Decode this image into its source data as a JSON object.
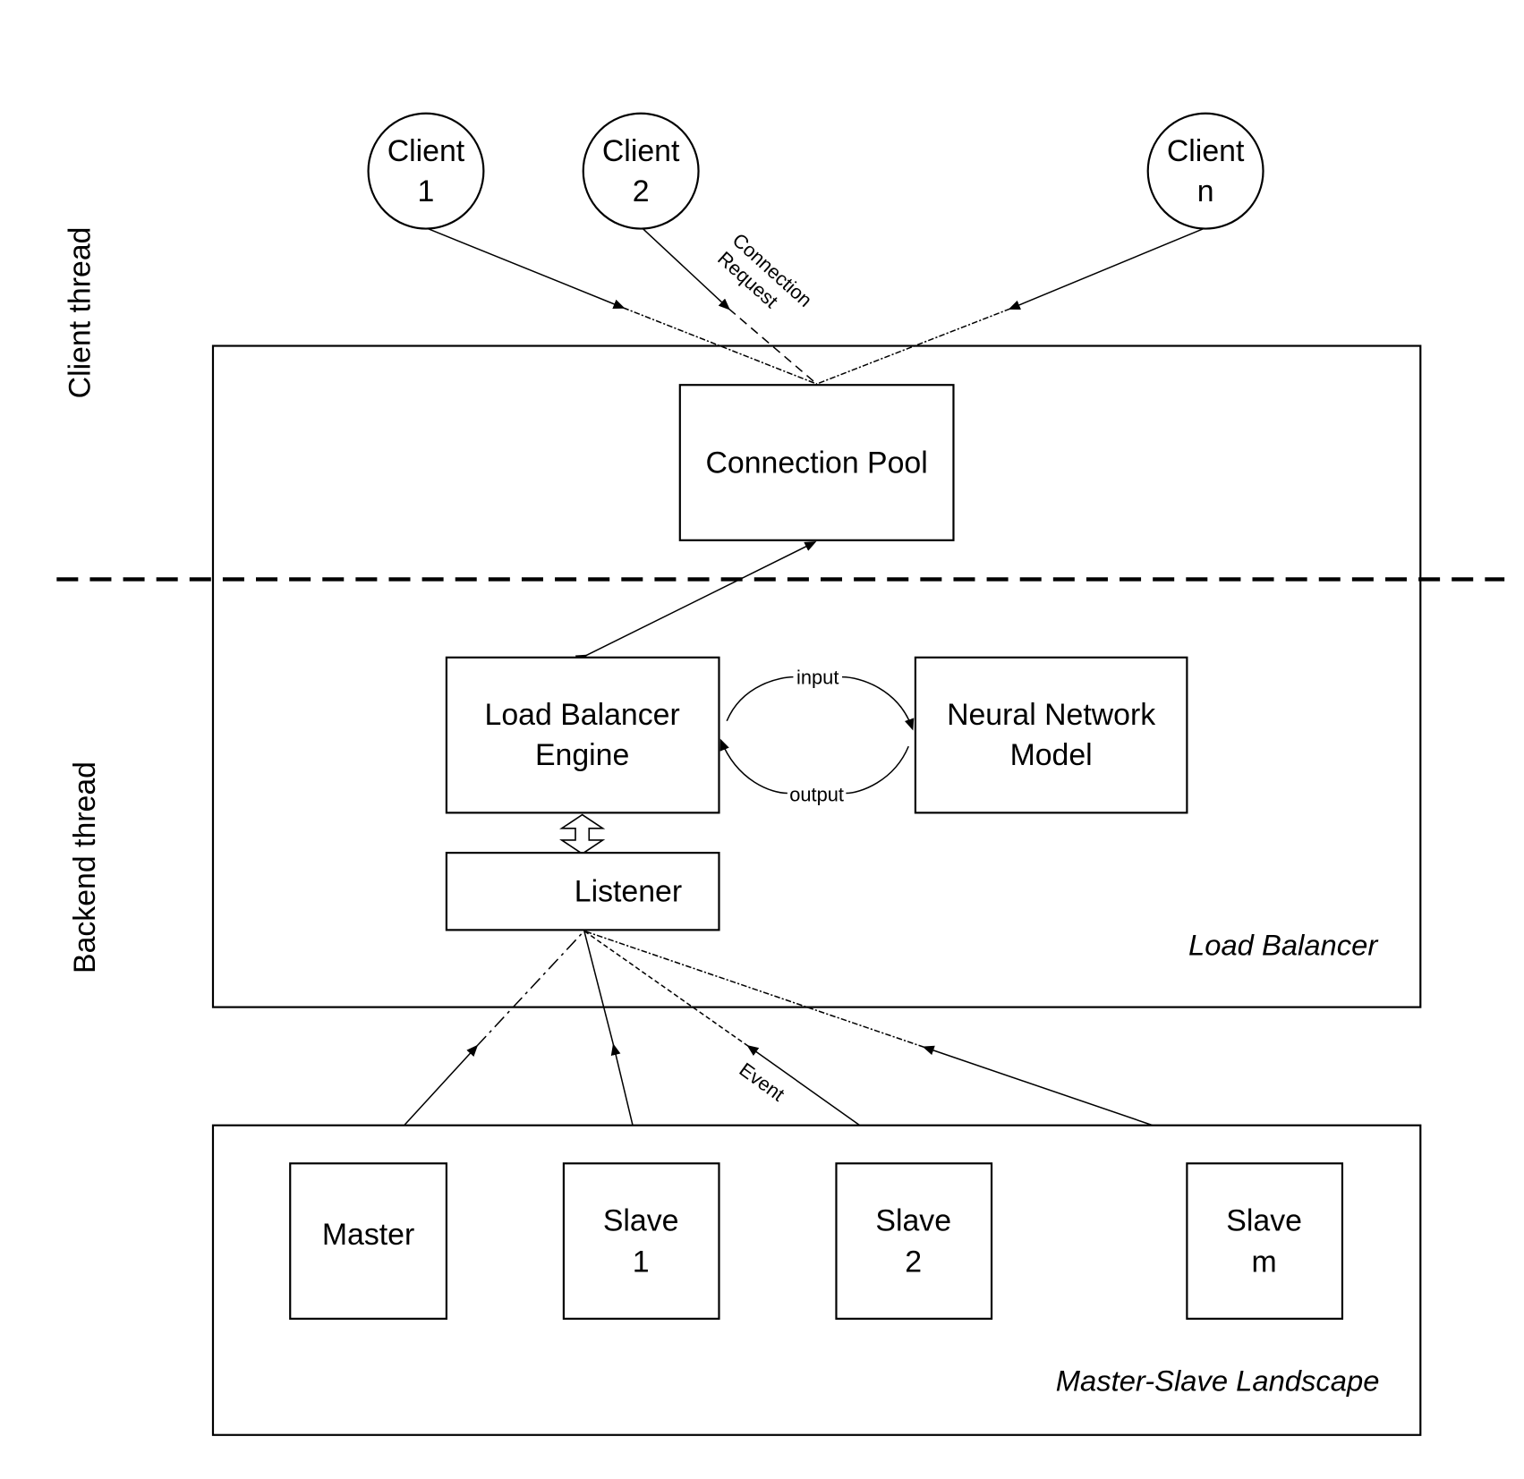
{
  "side_labels": {
    "client_thread": "Client thread",
    "backend_thread": "Backend thread"
  },
  "clients": [
    {
      "line1": "Client",
      "line2": "1"
    },
    {
      "line1": "Client",
      "line2": "2"
    },
    {
      "line1": "Client",
      "line2": "n"
    }
  ],
  "edge_labels": {
    "connection_request_1": "Connection",
    "connection_request_2": "Request",
    "input": "input",
    "output": "output",
    "event": "Event"
  },
  "load_balancer": {
    "title": "Load Balancer",
    "connection_pool": "Connection Pool",
    "engine_line1": "Load Balancer",
    "engine_line2": "Engine",
    "nn_line1": "Neural Network",
    "nn_line2": "Model",
    "listener": "Listener"
  },
  "landscape": {
    "title": "Master-Slave Landscape",
    "nodes": [
      {
        "line1": "Master",
        "line2": ""
      },
      {
        "line1": "Slave",
        "line2": "1"
      },
      {
        "line1": "Slave",
        "line2": "2"
      },
      {
        "line1": "Slave",
        "line2": "m"
      }
    ]
  }
}
